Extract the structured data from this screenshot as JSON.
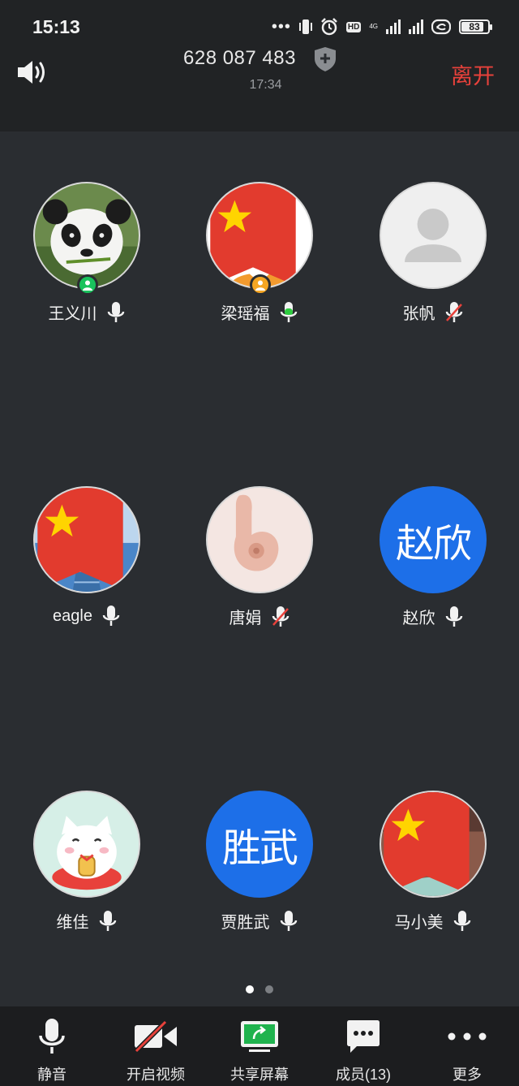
{
  "status_bar": {
    "time": "15:13",
    "network_label": "4G",
    "hd_label": "HD",
    "battery": "83"
  },
  "header": {
    "meeting_id": "628 087 483",
    "duration": "17:34",
    "leave_label": "离开"
  },
  "participants": [
    {
      "name": "王义川",
      "mic": "on",
      "avatar": "panda",
      "badge": "host"
    },
    {
      "name": "梁瑶福",
      "mic": "speaking",
      "avatar": "cartoon-boy",
      "badge": "cohost",
      "flag": true
    },
    {
      "name": "张帆",
      "mic": "muted",
      "avatar": "default"
    },
    {
      "name": "eagle",
      "mic": "on",
      "avatar": "blue-house",
      "flag": true
    },
    {
      "name": "唐娟",
      "mic": "muted",
      "avatar": "hand"
    },
    {
      "name": "赵欣",
      "mic": "on",
      "avatar": "text",
      "avatar_text": "赵欣"
    },
    {
      "name": "维佳",
      "mic": "on",
      "avatar": "cat"
    },
    {
      "name": "贾胜武",
      "mic": "on",
      "avatar": "text",
      "avatar_text": "胜武"
    },
    {
      "name": "马小美",
      "mic": "on",
      "avatar": "baby",
      "flag": true
    }
  ],
  "pager": {
    "pages": 2,
    "current": 1
  },
  "toolbar": {
    "mute_label": "静音",
    "video_label": "开启视频",
    "share_label": "共享屏幕",
    "members_label": "成员(13)",
    "more_label": "更多"
  },
  "colors": {
    "background": "#2a2d31",
    "header": "#212325",
    "leave": "#e8413b",
    "text_avatar": "#1d6fe8",
    "speaking": "#2ecc40",
    "muted_slash": "#e8413b",
    "share_green": "#1fb34e"
  }
}
